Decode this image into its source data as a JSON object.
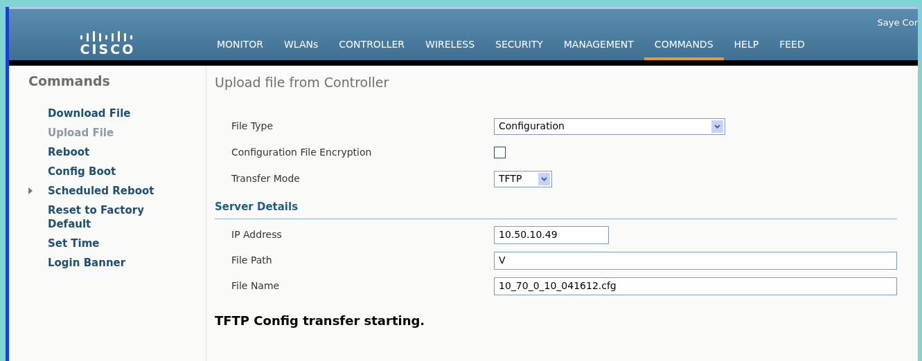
{
  "header": {
    "logo_text": "CISCO",
    "save_link": "Saye Cor"
  },
  "nav": [
    {
      "label": "MONITOR",
      "selected": false
    },
    {
      "label": "WLANs",
      "selected": false
    },
    {
      "label": "CONTROLLER",
      "selected": false
    },
    {
      "label": "WIRELESS",
      "selected": false
    },
    {
      "label": "SECURITY",
      "selected": false
    },
    {
      "label": "MANAGEMENT",
      "selected": false
    },
    {
      "label": "COMMANDS",
      "selected": true
    },
    {
      "label": "HELP",
      "selected": false
    },
    {
      "label": "FEED",
      "selected": false
    }
  ],
  "sidebar": {
    "title": "Commands",
    "items": [
      {
        "label": "Download File",
        "selected": false
      },
      {
        "label": "Upload File",
        "selected": true
      },
      {
        "label": "Reboot",
        "selected": false
      },
      {
        "label": "Config Boot",
        "selected": false
      },
      {
        "label": "Scheduled Reboot",
        "selected": false,
        "expandable": true
      },
      {
        "label": "Reset to Factory Default",
        "selected": false
      },
      {
        "label": "Set Time",
        "selected": false
      },
      {
        "label": "Login Banner",
        "selected": false
      }
    ]
  },
  "page_title": "Upload file from Controller",
  "settings": [
    {
      "kind": "select",
      "label": "File Type",
      "value": "Configuration",
      "wide": true
    },
    {
      "kind": "checkbox",
      "label": "Configuration File Encryption",
      "checked": false
    },
    {
      "kind": "select",
      "label": "Transfer Mode",
      "value": "TFTP",
      "wide": false
    }
  ],
  "server_section": {
    "title": "Server Details",
    "fields": [
      {
        "label": "IP Address",
        "value": "10.50.10.49",
        "wide": false
      },
      {
        "label": "File Path",
        "value": "V",
        "wide": true
      },
      {
        "label": "File Name",
        "value": "10_70_0_10_041612.cfg",
        "wide": true
      }
    ]
  },
  "status_message": "TFTP Config transfer starting."
}
